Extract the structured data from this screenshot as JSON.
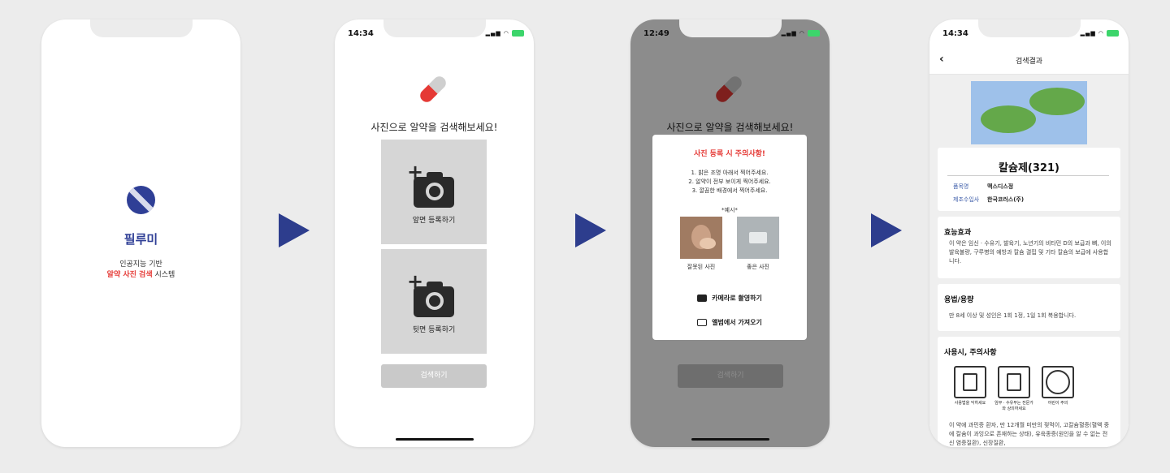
{
  "splash": {
    "app_name": "필루미",
    "tagline_line1": "인공지능 기반",
    "tagline_highlight": "알약 사진 검색",
    "tagline_suffix": " 시스템"
  },
  "register": {
    "status_time": "14:34",
    "heading": "사진으로 알약을 검색해보세요!",
    "front_label": "앞면 등록하기",
    "back_label": "뒷면 등록하기",
    "search_button": "검색하기"
  },
  "modal_screen": {
    "status_time": "12:49",
    "heading": "사진으로 알약을 검색해보세요!",
    "modal_title": "사진 등록 시 주의사항!",
    "tips": [
      "1. 밝은 조명 아래서 찍어주세요.",
      "2. 알약이 전부 보이게 찍어주세요.",
      "3. 깔끔한 배경에서 찍어주세요."
    ],
    "example_label": "*예시*",
    "bad_caption": "잘못된 사진",
    "good_caption": "좋은 사진",
    "camera_action": "카메라로 촬영하기",
    "album_action": "앨범에서 가져오기",
    "search_button": "검색하기"
  },
  "result": {
    "status_time": "14:34",
    "nav_title": "검색결과",
    "back_icon": "‹",
    "pill_name": "칼슘제(321)",
    "fields": [
      {
        "key": "품목명",
        "value": "맥스디스정"
      },
      {
        "key": "제조수입사",
        "value": "한국코러스(주)"
      }
    ],
    "effect_title": "효능효과",
    "effect_body": "이 약은 임신 · 수유기, 발육기, 노년기의 비타민 D의 보급과 뼈, 이의 발육불량, 구루병의 예방과 칼슘 결핍 및 기타 칼슘의 보급에 사용합니다.",
    "dosage_title": "용법/용량",
    "dosage_body": "만 8세 이상 및 성인은 1회 1정, 1일 1회 복용합니다.",
    "caution_title": "사용시, 주의사항",
    "caution_captions": [
      "사용법을 익히세요",
      "임부 · 수유부는 전문가와 상의하세요",
      "어린이 주의"
    ],
    "caution_body": "이 약에 과민증 환자, 만 12개월 미만의 젖먹이, 고칼슘혈증(혈액 중에 칼슘이 과잉으로 존재하는 상태), 유육종증(원인을 알 수 없는 전신 염증질환), 신장질환,"
  },
  "colors": {
    "brand": "#2f3f96",
    "accent": "#e53935",
    "arrow": "#2d3d8d"
  }
}
